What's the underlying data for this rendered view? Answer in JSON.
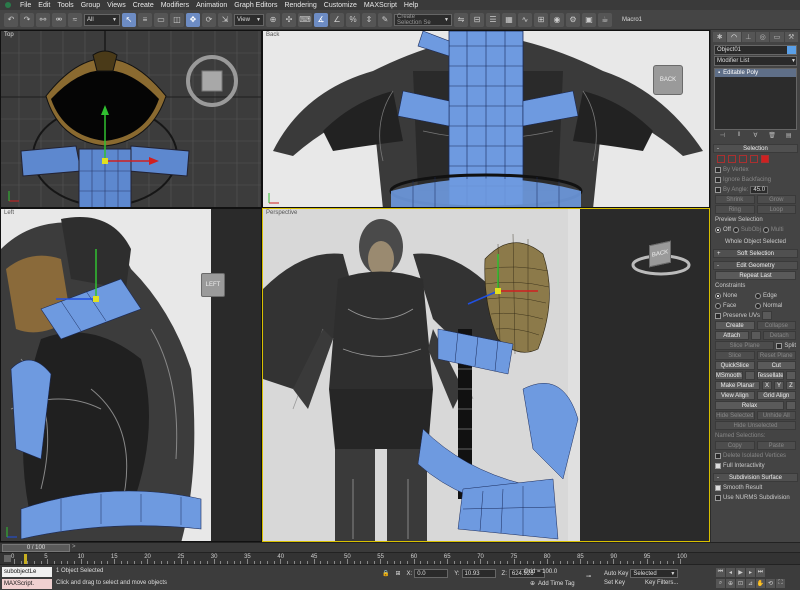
{
  "menu": [
    "File",
    "Edit",
    "Tools",
    "Group",
    "Views",
    "Create",
    "Modifiers",
    "Animation",
    "Graph Editors",
    "Rendering",
    "Customize",
    "MAXScript",
    "Help"
  ],
  "toolbar": {
    "filter_value": "All",
    "reference_coord": "View",
    "named_selection_placeholder": "Create Selection Se",
    "macro_label": "Macro1"
  },
  "viewports": {
    "top": {
      "label": "Top"
    },
    "back": {
      "label": "Back",
      "cube_face": "BACK"
    },
    "left": {
      "label": "Left",
      "cube_face": "LEFT"
    },
    "perspective": {
      "label": "Perspective",
      "cube_face": "BACK"
    }
  },
  "command_panel": {
    "object_name": "Object01",
    "object_color": "#5aa0e8",
    "modifier_list": "Modifier List",
    "stack_item": "Editable Poly",
    "selection": {
      "title": "Selection",
      "by_vertex": "By Vertex",
      "ignore_backfacing": "Ignore Backfacing",
      "by_angle": "By Angle:",
      "by_angle_value": "45.0",
      "shrink": "Shrink",
      "grow": "Grow",
      "ring": "Ring",
      "loop": "Loop",
      "preview_selection": "Preview Selection",
      "off": "Off",
      "subobj": "SubObj",
      "multi": "Multi",
      "status": "Whole Object Selected"
    },
    "soft_selection": {
      "title": "Soft Selection"
    },
    "edit_geometry": {
      "title": "Edit Geometry",
      "repeat_last": "Repeat Last",
      "constraints": "Constraints",
      "none": "None",
      "edge": "Edge",
      "face": "Face",
      "normal": "Normal",
      "preserve_uvs": "Preserve UVs",
      "create": "Create",
      "collapse": "Collapse",
      "attach": "Attach",
      "detach": "Detach",
      "slice_plane": "Slice Plane",
      "split": "Split",
      "slice": "Slice",
      "reset_plane": "Reset Plane",
      "quickslice": "QuickSlice",
      "cut": "Cut",
      "msmooth": "MSmooth",
      "tessellate": "Tessellate",
      "make_planar": "Make Planar",
      "x": "X",
      "y": "Y",
      "z": "Z",
      "view_align": "View Align",
      "grid_align": "Grid Align",
      "relax": "Relax",
      "hide_selected": "Hide Selected",
      "unhide_all": "Unhide All",
      "hide_unselected": "Hide Unselected",
      "named_selections": "Named Selections:",
      "copy": "Copy",
      "paste": "Paste",
      "delete_isolated": "Delete Isolated Vertices",
      "full_interactivity": "Full Interactivity"
    },
    "subdivision_surface": {
      "title": "Subdivision Surface",
      "smooth_result": "Smooth Result",
      "use_nurms": "Use NURMS Subdivision"
    }
  },
  "timeline": {
    "frame_display": "0 / 100",
    "ticks": [
      "0",
      "5",
      "10",
      "15",
      "20",
      "25",
      "30",
      "35",
      "40",
      "45",
      "50",
      "55",
      "60",
      "65",
      "70",
      "75",
      "80",
      "85",
      "90",
      "95",
      "100"
    ]
  },
  "status": {
    "script_line_1": "subobjectLe",
    "script_line_2": "MAXScript.",
    "selection_status": "1 Object Selected",
    "prompt": "Click and drag to select and move objects",
    "x_label": "X:",
    "x_value": "0.0",
    "y_label": "Y:",
    "y_value": "10.93",
    "z_label": "Z:",
    "z_value": "624.926",
    "grid": "Grid = 100.0",
    "add_time_tag": "Add Time Tag",
    "auto_key": "Auto Key",
    "auto_key_value": "Selected",
    "set_key": "Set Key",
    "key_filters": "Key Filters..."
  },
  "colors": {
    "mesh_blue": "#6e9ae0",
    "active_viewport": "#d8c000",
    "viewport_bg": "#3c3c3c"
  }
}
